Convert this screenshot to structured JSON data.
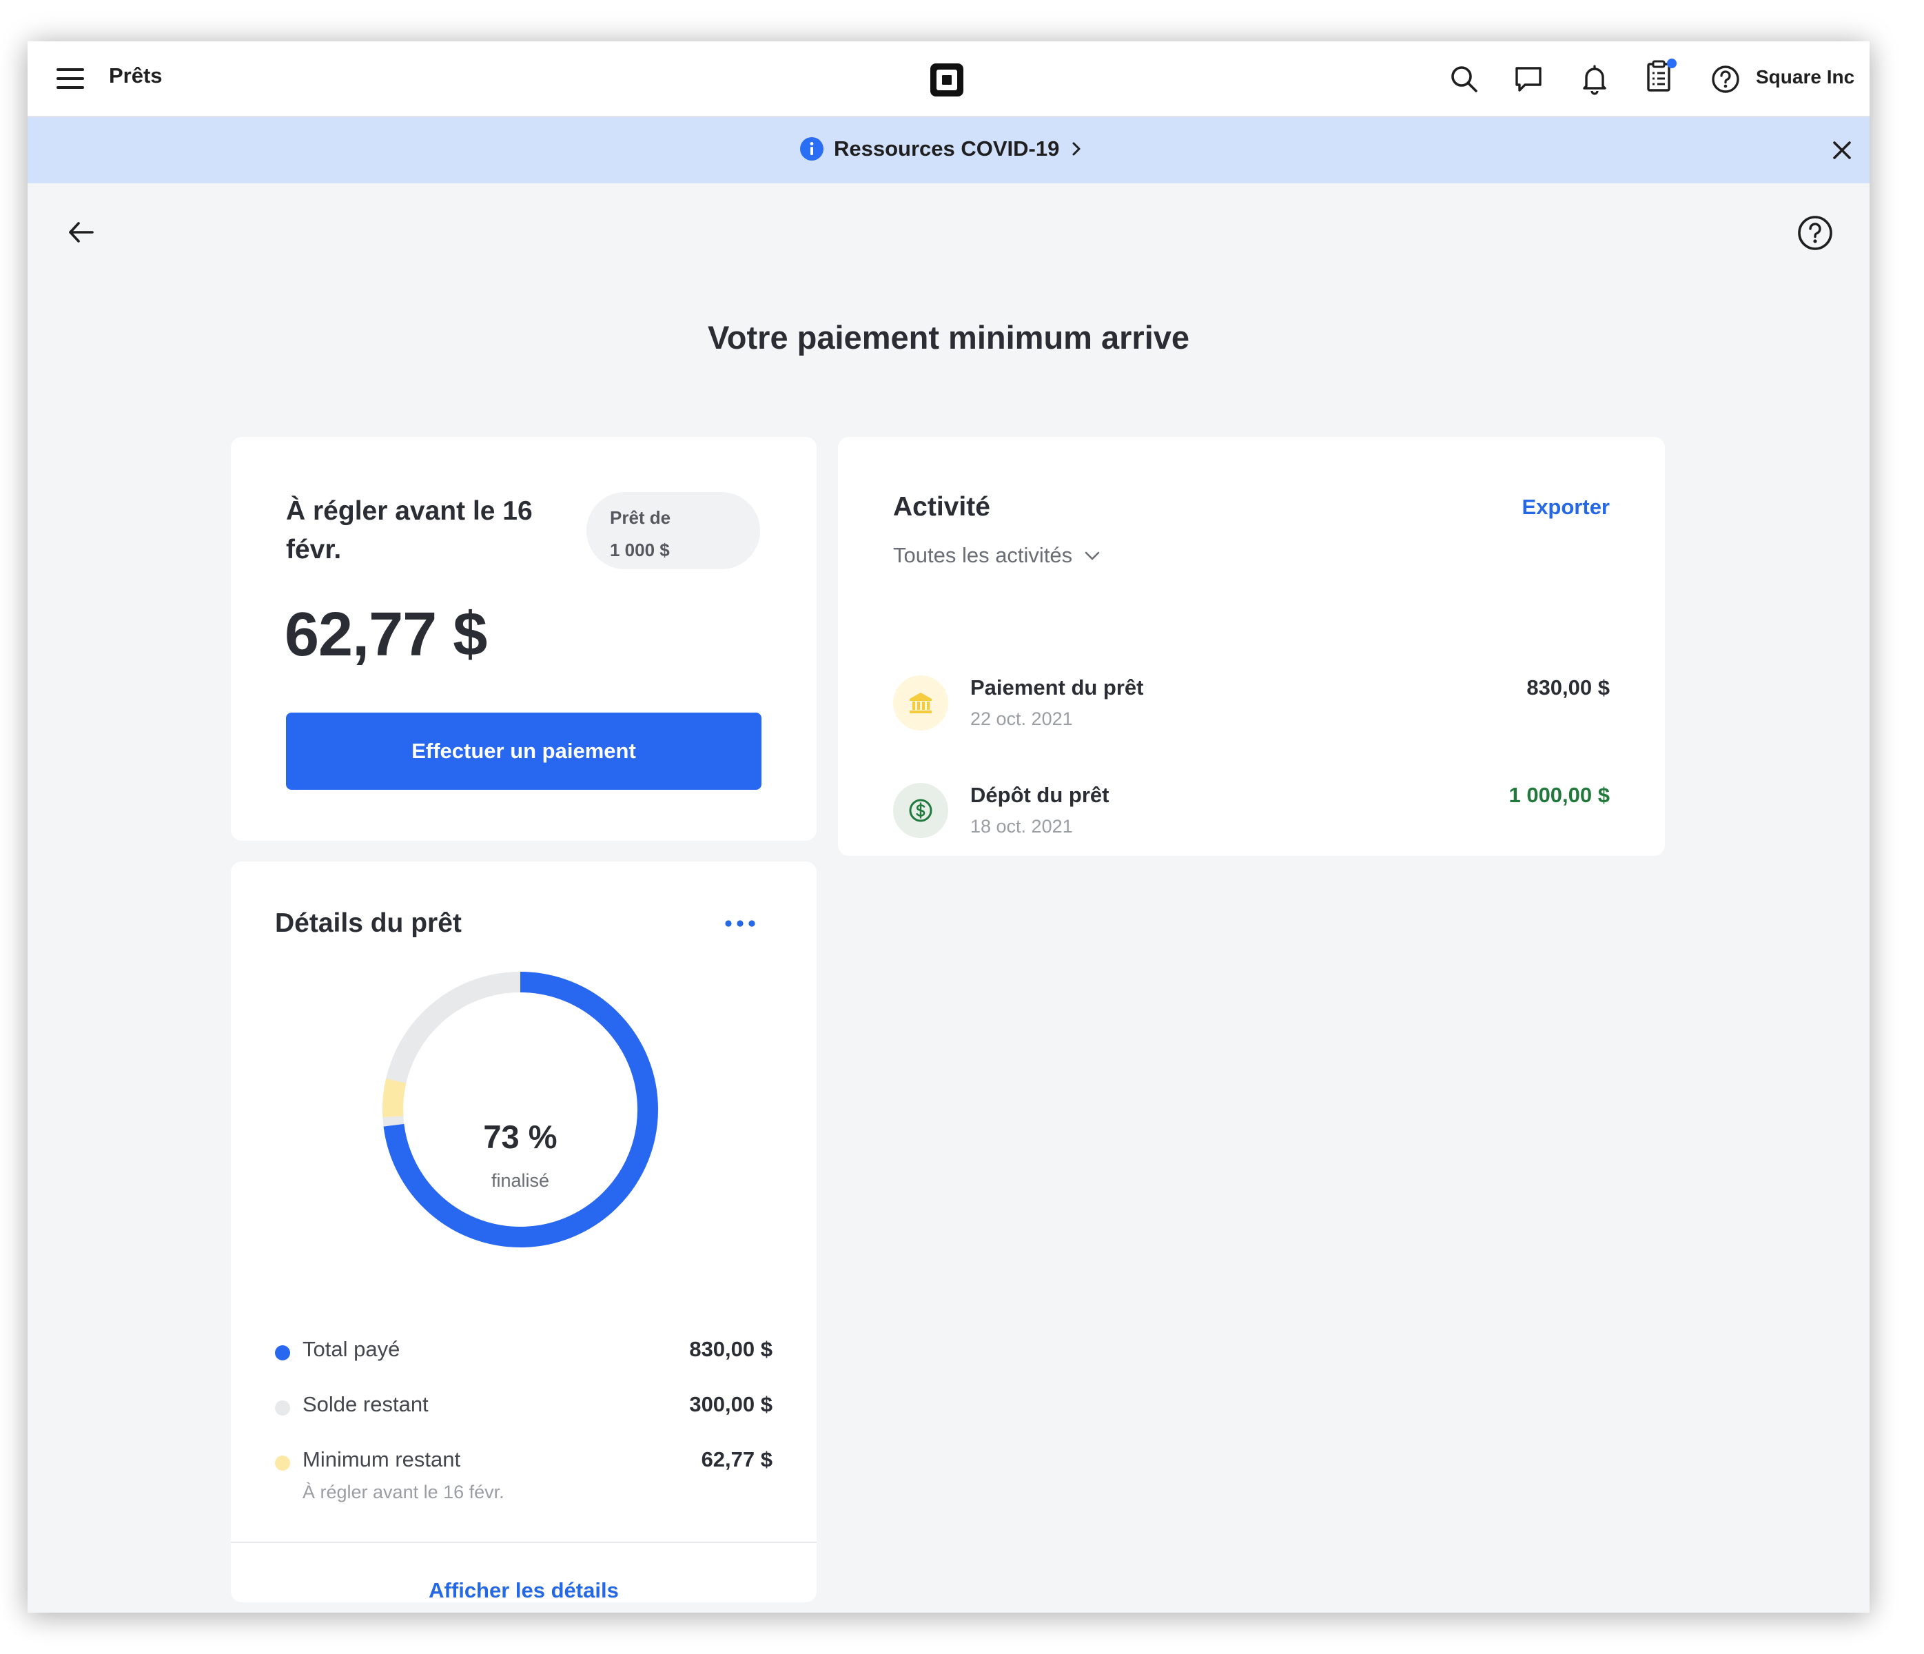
{
  "app": {
    "title": "Prêts",
    "org_name": "Square Inc",
    "icons": [
      "menu-icon",
      "square-logo-icon",
      "search-icon",
      "messages-icon",
      "notifications-icon",
      "orders-icon",
      "help-icon"
    ]
  },
  "banner": {
    "text": "Ressources COVID-19",
    "icon": "info-icon",
    "close_icon": "close-icon"
  },
  "page": {
    "title": "Votre paiement minimum arrive"
  },
  "due_card": {
    "title": "À régler avant le 16 févr.",
    "pill_line1": "Prêt de",
    "pill_line2": "1 000 $",
    "amount": "62,77 $",
    "button": "Effectuer un paiement"
  },
  "activity": {
    "title": "Activité",
    "export": "Exporter",
    "filter": "Toutes les activités",
    "items": [
      {
        "name": "Paiement du prêt",
        "date": "22 oct. 2021",
        "amount": "830,00 $",
        "icon": "bank-icon"
      },
      {
        "name": "Dépôt du prêt",
        "date": "18 oct. 2021",
        "amount": "1 000,00 $",
        "icon": "dollar-icon"
      }
    ]
  },
  "details": {
    "title": "Détails du prêt",
    "percent_label": "73 %",
    "percent_sub": "finalisé",
    "completion": 0.73,
    "legend": [
      {
        "label": "Total payé",
        "amount": "830,00 $"
      },
      {
        "label": "Solde restant",
        "amount": "300,00 $"
      },
      {
        "label": "Minimum restant",
        "amount": "62,77 $",
        "sub": "À régler avant le 16 févr."
      }
    ],
    "link": "Afficher les détails"
  },
  "colors": {
    "accent": "#2868f0",
    "link": "#2468e6",
    "remaining": "#e8e9eb",
    "minimum": "#fde9a6",
    "deposit": "#217a3c",
    "banner": "#d2e1fb"
  }
}
